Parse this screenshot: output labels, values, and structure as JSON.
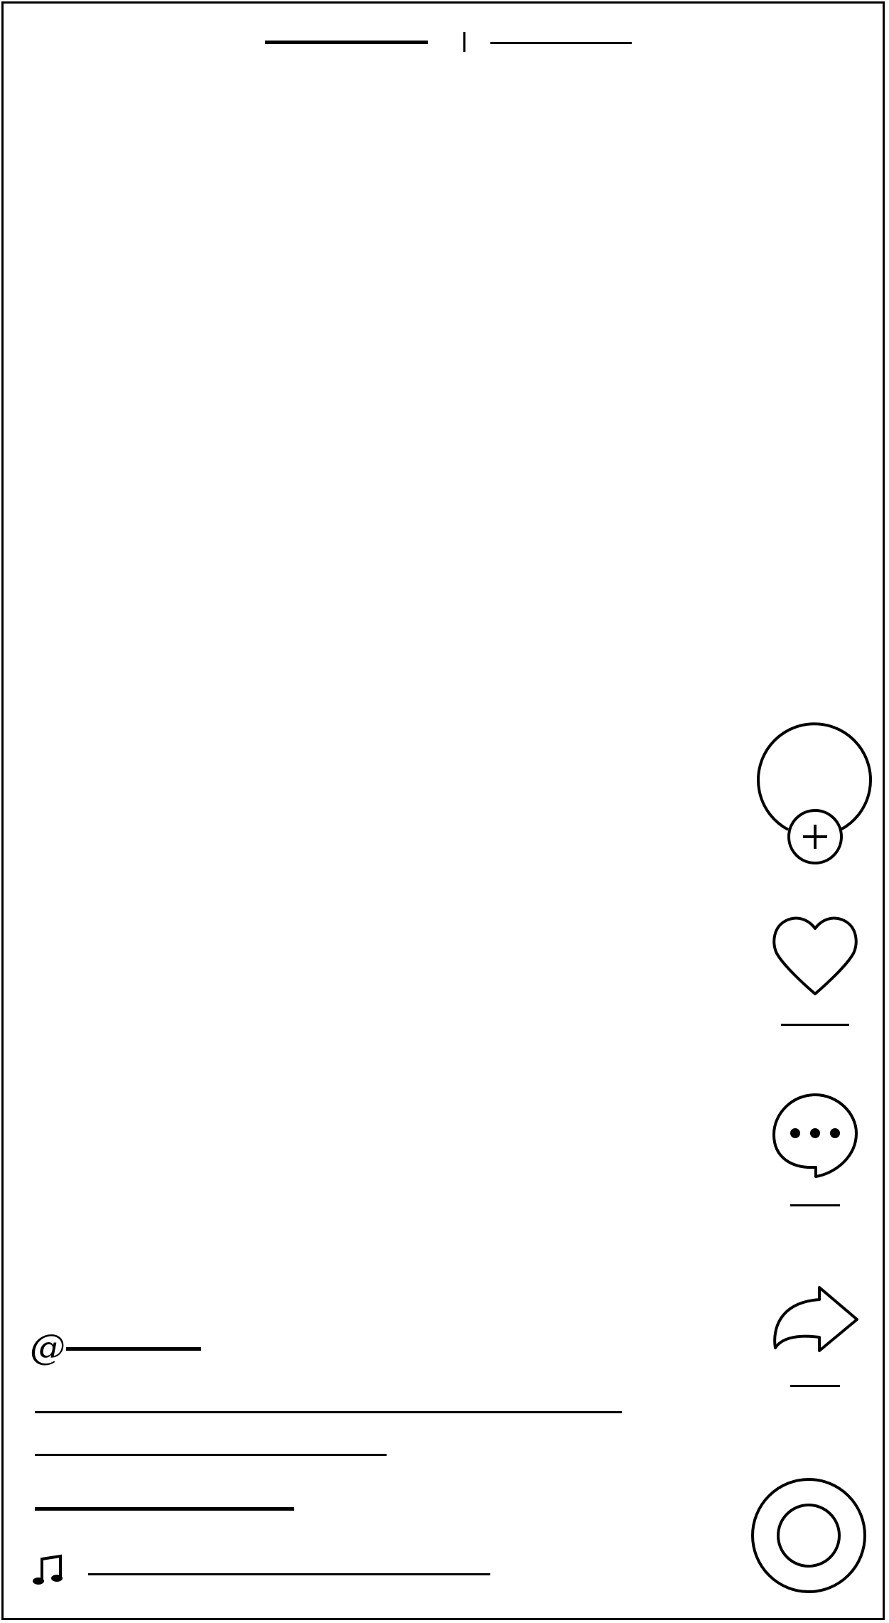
{
  "top_nav": {
    "tabs": [
      {
        "name": "following",
        "label": ""
      },
      {
        "name": "for-you",
        "label": ""
      }
    ],
    "separator": "|"
  },
  "creator": {
    "avatar_icon": "avatar-circle",
    "follow_icon": "plus-icon"
  },
  "actions": {
    "like": {
      "icon": "heart-icon",
      "count": ""
    },
    "comment": {
      "icon": "comment-bubble-icon",
      "count": ""
    },
    "share": {
      "icon": "share-arrow-icon",
      "count": ""
    }
  },
  "caption": {
    "at_symbol": "@",
    "username": "",
    "description_line_1": "",
    "description_line_2": "",
    "hashtags": ""
  },
  "music": {
    "icon": "music-note-icon",
    "track": "",
    "disc_icon": "music-disc-icon"
  }
}
